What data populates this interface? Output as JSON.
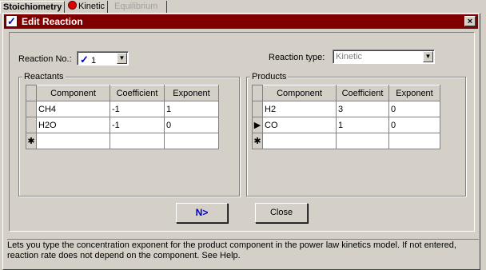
{
  "tabs": [
    {
      "label": "Stoichiometry"
    },
    {
      "label": "Kinetic"
    },
    {
      "label": "Equilibrium"
    }
  ],
  "dialog": {
    "title": "Edit Reaction",
    "close_label": "×",
    "reaction_no_label": "Reaction No.:",
    "reaction_no_value": "1",
    "reaction_type_label": "Reaction type:",
    "reaction_type_value": "Kinetic",
    "reactants": {
      "label": "Reactants",
      "columns": [
        "Component",
        "Coefficient",
        "Exponent"
      ],
      "rows": [
        {
          "component": "CH4",
          "coefficient": "-1",
          "exponent": "1"
        },
        {
          "component": "H2O",
          "coefficient": "-1",
          "exponent": "0"
        }
      ]
    },
    "products": {
      "label": "Products",
      "columns": [
        "Component",
        "Coefficient",
        "Exponent"
      ],
      "rows": [
        {
          "component": "H2",
          "coefficient": "3",
          "exponent": "0"
        },
        {
          "component": "CO",
          "coefficient": "1",
          "exponent": "0"
        }
      ]
    },
    "next_button": "N>",
    "close_button": "Close",
    "status_text": "Lets you type the concentration exponent for the product component in the power law kinetics model. If not entered, reaction rate does not depend on the component. See Help."
  },
  "colors": {
    "titlebar": "#800000",
    "accent": "#0000cc"
  }
}
